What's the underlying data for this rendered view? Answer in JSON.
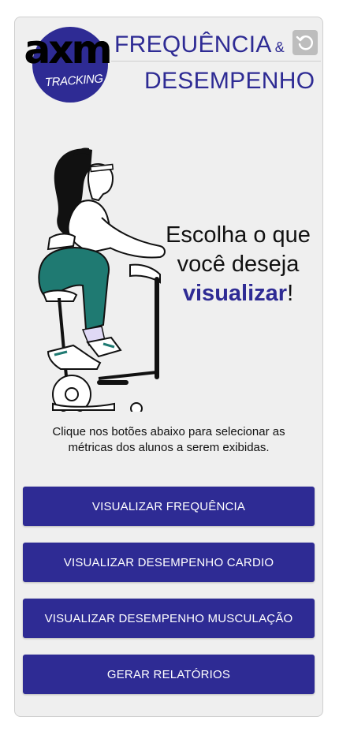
{
  "brand": {
    "logo_text": "axm",
    "logo_sub": "TRACKING"
  },
  "header": {
    "title_line1": "FREQUÊNCIA",
    "ampersand": "&",
    "title_line2": "DESEMPENHO"
  },
  "icons": {
    "reset": "reset-icon",
    "illustration": "exercise-bike-illustration"
  },
  "hero": {
    "headline_pre": "Escolha o que você deseja",
    "headline_em": "visualizar",
    "headline_post": "!"
  },
  "instructions": "Clique nos botões abaixo para selecionar as métricas dos alunos a serem exibidas.",
  "buttons": {
    "frequency": "VISUALIZAR FREQUÊNCIA",
    "cardio": "VISUALIZAR DESEMPENHO CARDIO",
    "muscle": "VISUALIZAR DESEMPENHO MUSCULAÇÃO",
    "reports": "GERAR RELATÓRIOS"
  },
  "colors": {
    "primary": "#2e2b94",
    "card_bg": "#efefef",
    "illustration_accent": "#1f7a72"
  }
}
